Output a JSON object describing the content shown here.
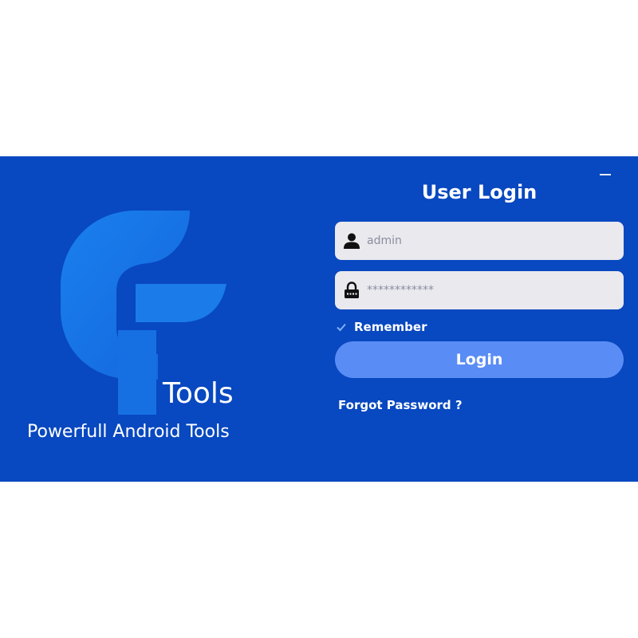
{
  "brand": {
    "name": "Tools",
    "tagline": "Powerfull Android Tools",
    "logo_icon": "gf-logo-icon"
  },
  "login": {
    "title": "User Login",
    "username": {
      "value": "admin",
      "icon": "user-icon"
    },
    "password": {
      "value": "************",
      "icon": "lock-icon"
    },
    "remember": {
      "label": "Remember",
      "checked": true
    },
    "button_label": "Login",
    "forgot_label": "Forgot Password ?"
  },
  "window": {
    "minimize_icon": "minimize-icon"
  },
  "colors": {
    "background": "#0848c0",
    "logo": "#1677e8",
    "field_bg": "#e9e9ee",
    "button": "#5a8cf5",
    "text": "#ffffff"
  }
}
